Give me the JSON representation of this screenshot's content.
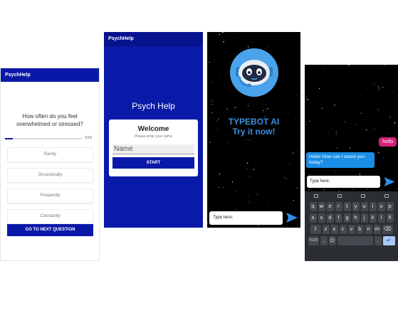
{
  "colors": {
    "brand_blue": "#0a18a8",
    "bot_blue": "#1a8ee6",
    "user_pink": "#d8207a",
    "star_bg": "#000000"
  },
  "quiz_screen": {
    "app_title": "PsychHelp",
    "question": "How often do you feel overwhelmed or stressed?",
    "progress_text": "1/10",
    "progress_fraction": 0.1,
    "options": [
      "Rarely",
      "Occasionally",
      "Frequently",
      "Constantly"
    ],
    "next_button": "GO TO NEXT QUESTION"
  },
  "welcome_screen": {
    "app_title": "PsychHelp",
    "title": "Psych Help",
    "card_title": "Welcome",
    "card_hint": "Please enter your name",
    "name_placeholder": "Name",
    "start_button": "START"
  },
  "splash_screen": {
    "brand_line1": "TYPEBOT AI",
    "brand_line2": "Try it now!",
    "input_placeholder": "Type here:",
    "send_icon": "send-icon"
  },
  "chat_screen": {
    "user_message": "hello",
    "bot_message": "Hello! How can I assist you today?",
    "input_placeholder": "Type here:",
    "keyboard": {
      "row1": [
        "q",
        "w",
        "e",
        "r",
        "t",
        "y",
        "u",
        "i",
        "o",
        "p"
      ],
      "row2": [
        "a",
        "s",
        "d",
        "f",
        "g",
        "h",
        "j",
        "k",
        "l",
        "ñ"
      ],
      "row3": [
        "z",
        "x",
        "c",
        "v",
        "b",
        "n",
        "m"
      ],
      "symbols_key": "?123",
      "comma_key": ",",
      "period_key": "."
    }
  }
}
